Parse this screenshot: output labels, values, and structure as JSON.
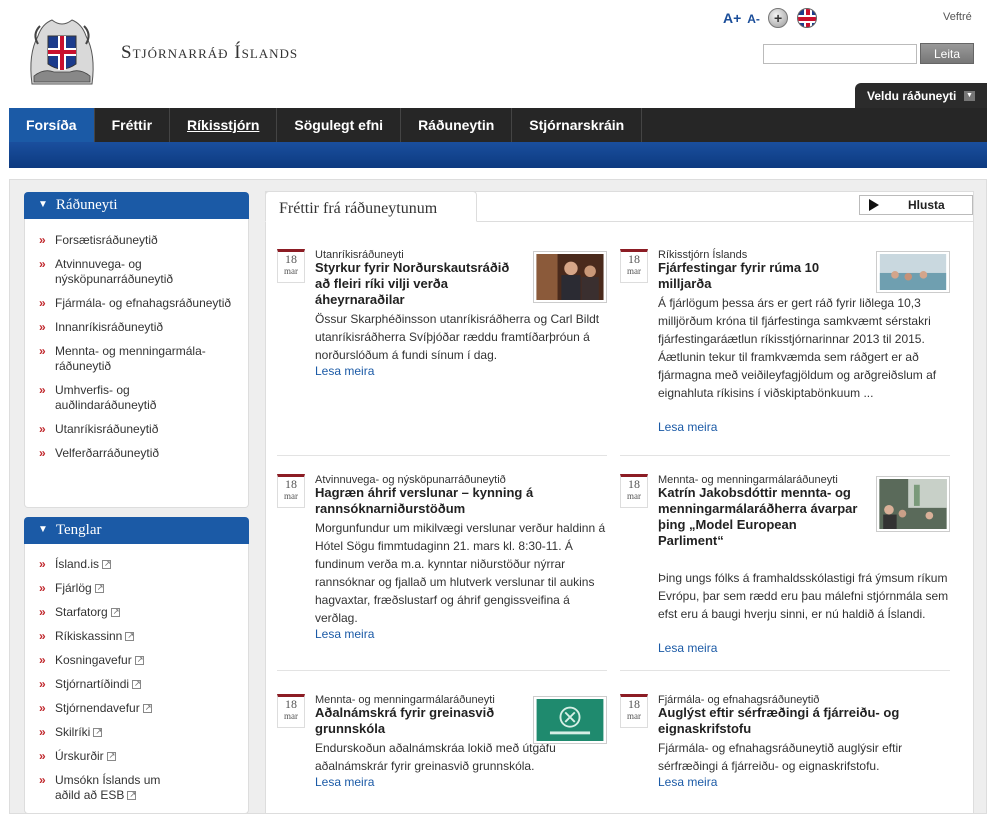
{
  "header": {
    "site_name": "Stjórnarráð Íslands",
    "font_larger": "A+",
    "font_smaller": "A-",
    "site_map": "Veftré",
    "search_placeholder": "",
    "search_button": "Leita",
    "ministry_selector": "Veldu ráðuneyti"
  },
  "nav": {
    "items": [
      "Forsíða",
      "Fréttir",
      "Ríkisstjórn",
      "Sögulegt efni",
      "Ráðuneytin",
      "Stjórnarskráin"
    ]
  },
  "sidebar": {
    "ministries": {
      "title": "Ráðuneyti",
      "items": [
        "Forsætisráðuneytið",
        "Atvinnuvega- og nýsköpunarráðuneytið",
        "Fjármála- og efnahagsráðuneytið",
        "Innanríkisráðuneytið",
        "Mennta- og menningarmála-ráðuneytið",
        "Umhverfis- og auðlindaráðuneytið",
        "Utanríkisráðuneytið",
        "Velferðarráðuneytið"
      ]
    },
    "links": {
      "title": "Tenglar",
      "items": [
        "Ísland.is",
        "Fjárlög",
        "Starfatorg",
        "Ríkiskassinn",
        "Kosningavefur",
        "Stjórnartíðindi",
        "Stjórnendavefur",
        "Skilríki",
        "Úrskurðir",
        "Umsókn Íslands um aðild að ESB"
      ]
    }
  },
  "main": {
    "tab_title": "Fréttir frá ráðuneytunum",
    "listen_button": "Hlusta",
    "read_more": "Lesa meira",
    "news": [
      {
        "day": "18",
        "month": "mar",
        "category": "Utanríkisráðuneyti",
        "title": "Styrkur fyrir Norðurskautsráðið að fleiri ríki vilji verða áheyrnaraðilar",
        "text": "Össur Skarphéðinsson utanríkisráðherra og Carl Bildt utanríkisráðherra Svíþjóðar ræddu framtíðarþróun á norðurslóðum á fundi sínum í dag."
      },
      {
        "day": "18",
        "month": "mar",
        "category": "Ríkisstjórn Íslands",
        "title": "Fjárfestingar fyrir rúma 10 milljarða",
        "text": "Á fjárlögum þessa árs er gert ráð fyrir liðlega 10,3 milljörðum króna til fjárfestinga samkvæmt sérstakri fjárfestingaráætlun ríkisstjórnarinnar 2013 til 2015. Áætlunin tekur til framkvæmda sem ráðgert er að fjármagna með veiðileyfagjöldum og arðgreiðslum af eignahluta ríkisins í viðskiptabönkuum ..."
      },
      {
        "day": "18",
        "month": "mar",
        "category": "Atvinnuvega- og nýsköpunarráðuneytið",
        "title": "Hagræn áhrif verslunar – kynning á rannsóknarniðurstöðum",
        "text": "Morgunfundur um mikilvægi verslunar verður haldinn á Hótel Sögu fimmtudaginn 21. mars kl. 8:30-11. Á fundinum verða m.a. kynntar niðurstöður nýrrar rannsóknar og fjallað um hlutverk verslunar til aukins hagvaxtar, fræðslustarf og áhrif gengissveifina á verðlag."
      },
      {
        "day": "18",
        "month": "mar",
        "category": "Mennta- og menningarmálaráðuneyti",
        "title": "Katrín Jakobsdóttir mennta- og menningarmálaráðherra ávarpar þing „Model European Parliment“",
        "text": "Þing ungs fólks á framhaldsskólastigi frá ýmsum ríkum Evrópu, þar sem rædd eru þau málefni stjórnmála sem efst eru á baugi hverju sinni, er nú haldið á Íslandi."
      },
      {
        "day": "18",
        "month": "mar",
        "category": "Mennta- og menningarmálaráðuneyti",
        "title": "Aðalnámskrá fyrir greinasvið grunnskóla",
        "text": "Endurskoðun aðalnámskráa lokið með útgáfu aðalnámskrár fyrir greinasvið grunnskóla."
      },
      {
        "day": "18",
        "month": "mar",
        "category": "Fjármála- og efnahagsráðuneytið",
        "title": "Auglýst eftir sérfræðingi á fjárreiðu- og eignaskrifstofu",
        "text": "Fjármála- og efnahagsráðuneytið auglýsir eftir sérfræðingi á fjárreiðu- og eignaskrifstofu."
      }
    ]
  }
}
